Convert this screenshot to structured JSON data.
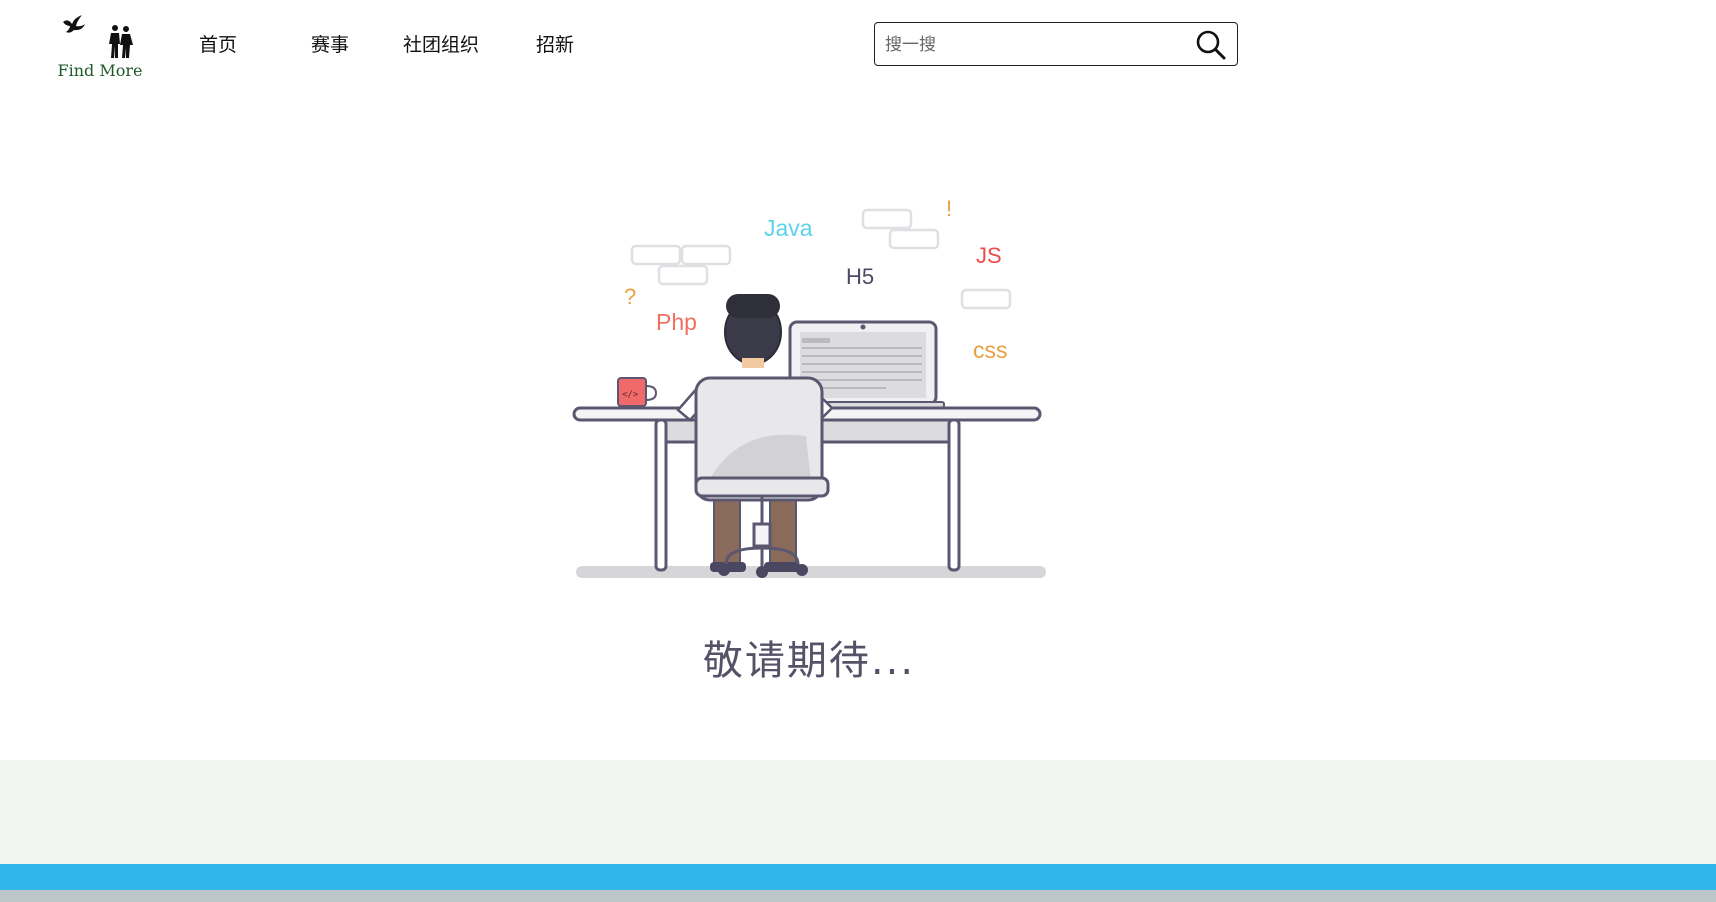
{
  "logo": {
    "text": "Find More"
  },
  "nav": {
    "home": "首页",
    "events": "赛事",
    "clubs": "社团组织",
    "recruit": "招新"
  },
  "search": {
    "placeholder": "搜一搜",
    "value": ""
  },
  "illustration": {
    "labels": {
      "java": "Java",
      "h5": "H5",
      "js": "JS",
      "php": "Php",
      "css": "css",
      "question": "?",
      "exclaim": "!",
      "mug": "</>"
    }
  },
  "main": {
    "message": "敬请期待..."
  },
  "colors": {
    "footer_blue": "#30b6ea",
    "footer_gray": "#f1f5f2",
    "logo_green": "#1e5a28"
  }
}
